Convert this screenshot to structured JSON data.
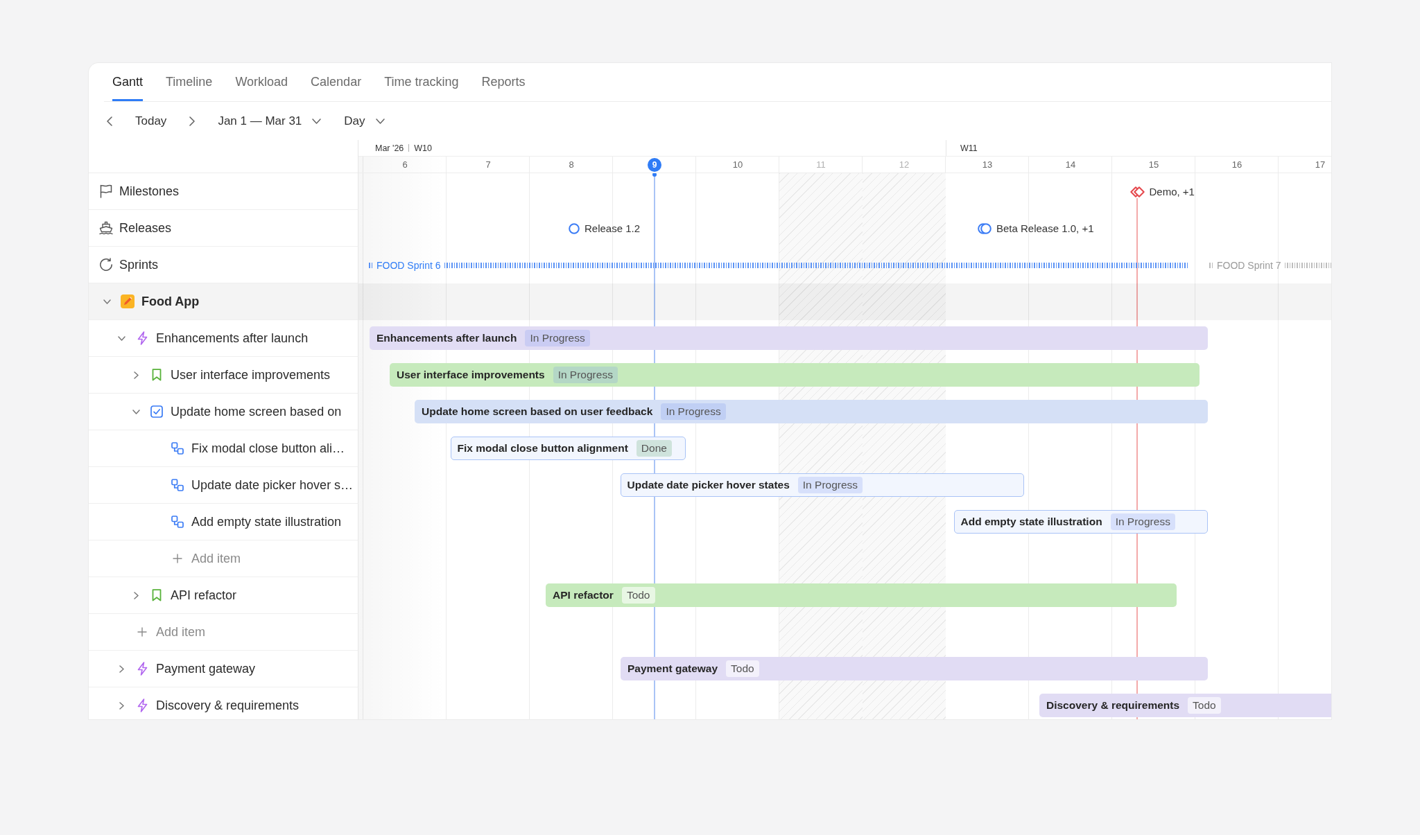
{
  "tabs": [
    {
      "label": "Gantt",
      "selected": true
    },
    {
      "label": "Timeline",
      "selected": false
    },
    {
      "label": "Workload",
      "selected": false
    },
    {
      "label": "Calendar",
      "selected": false
    },
    {
      "label": "Time tracking",
      "selected": false
    },
    {
      "label": "Reports",
      "selected": false
    }
  ],
  "toolbar": {
    "today": "Today",
    "range": "Jan 1 — Mar 31",
    "scale": "Day"
  },
  "header": {
    "month": "Mar '26",
    "days": [
      {
        "label": "6",
        "week": "W10",
        "weekend": false,
        "today": false
      },
      {
        "label": "7",
        "weekend": false,
        "today": false
      },
      {
        "label": "8",
        "weekend": false,
        "today": false
      },
      {
        "label": "9",
        "weekend": false,
        "today": true
      },
      {
        "label": "10",
        "weekend": false,
        "today": false
      },
      {
        "label": "11",
        "weekend": true,
        "today": false
      },
      {
        "label": "12",
        "weekend": true,
        "today": false
      },
      {
        "label": "13",
        "week": "W11",
        "weekend": false,
        "today": false
      },
      {
        "label": "14",
        "weekend": false,
        "today": false
      },
      {
        "label": "15",
        "weekend": false,
        "today": false
      },
      {
        "label": "16",
        "weekend": false,
        "today": false
      },
      {
        "label": "17",
        "weekend": false,
        "today": false
      }
    ]
  },
  "lanes": [
    {
      "kind": "milestones",
      "label": "Milestones",
      "markers": [
        {
          "label": "Demo, +1",
          "grouped": true
        }
      ]
    },
    {
      "kind": "releases",
      "label": "Releases",
      "markers": [
        {
          "label": "Release 1.2",
          "grouped": false
        },
        {
          "label": "Beta Release 1.0, +1",
          "grouped": true
        }
      ]
    },
    {
      "kind": "sprints",
      "label": "Sprints",
      "sprints": [
        {
          "label": "FOOD Sprint 6",
          "active": true
        },
        {
          "label": "FOOD Sprint 7",
          "active": false
        }
      ]
    }
  ],
  "tree": [
    {
      "kind": "project",
      "label": "Food App",
      "expanded": true,
      "children": [
        {
          "kind": "epic",
          "label": "Enhancements after launch",
          "expanded": true,
          "bar": {
            "label": "Enhancements after launch",
            "status": {
              "label": "In Progress",
              "kind": "in_progress"
            }
          },
          "children": [
            {
              "kind": "story",
              "label": "User interface improvements",
              "expanded": false,
              "bar": {
                "label": "User interface improvements",
                "status": {
                  "label": "In Progress",
                  "kind": "in_progress"
                }
              }
            },
            {
              "kind": "task",
              "label": "Update home screen based on",
              "expanded": true,
              "bar": {
                "label": "Update home screen based on user feedback",
                "status": {
                  "label": "In Progress",
                  "kind": "in_progress"
                }
              },
              "children": [
                {
                  "kind": "subtask",
                  "label": "Fix modal close button ali…",
                  "bar": {
                    "label": "Fix modal close button alignment",
                    "status": {
                      "label": "Done",
                      "kind": "done"
                    }
                  }
                },
                {
                  "kind": "subtask",
                  "label": "Update date picker hover s…",
                  "bar": {
                    "label": "Update date picker hover states",
                    "status": {
                      "label": "In Progress",
                      "kind": "in_progress"
                    }
                  }
                },
                {
                  "kind": "subtask",
                  "label": "Add empty state illustration",
                  "bar": {
                    "label": "Add empty state illustration",
                    "status": {
                      "label": "In Progress",
                      "kind": "in_progress"
                    }
                  }
                },
                {
                  "kind": "add",
                  "label": "Add item"
                }
              ]
            },
            {
              "kind": "story",
              "label": "API refactor",
              "expanded": false,
              "bar": {
                "label": "API refactor",
                "status": {
                  "label": "Todo",
                  "kind": "todo"
                }
              }
            }
          ]
        },
        {
          "kind": "add",
          "label": "Add item"
        },
        {
          "kind": "epic",
          "label": "Payment gateway",
          "expanded": false,
          "bar": {
            "label": "Payment gateway",
            "status": {
              "label": "Todo",
              "kind": "todo"
            }
          }
        },
        {
          "kind": "epic",
          "label": "Discovery & requirements",
          "expanded": false,
          "bar": {
            "label": "Discovery & requirements",
            "status": {
              "label": "Todo",
              "kind": "todo"
            }
          }
        }
      ]
    }
  ]
}
